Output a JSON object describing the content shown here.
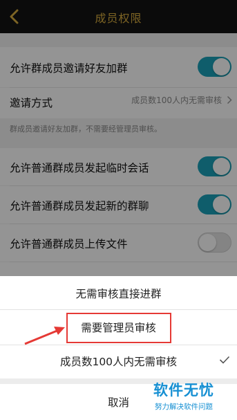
{
  "header": {
    "title": "成员权限"
  },
  "settings": {
    "allow_invite": {
      "label": "允许群成员邀请好友加群",
      "state": "on"
    },
    "invite_method": {
      "label": "邀请方式",
      "value": "成员数100人内无需审核"
    },
    "hint": "群成员邀请好友加群，不需要经管理员审核。",
    "temp_chat": {
      "label": "允许普通群成员发起临时会话",
      "state": "on"
    },
    "new_group": {
      "label": "允许普通群成员发起新的群聊",
      "state": "on"
    },
    "upload_file": {
      "label": "允许普通群成员上传文件",
      "state": "off"
    }
  },
  "sheet": {
    "options": [
      {
        "label": "无需审核直接进群",
        "selected": false
      },
      {
        "label": "需要管理员审核",
        "selected": false
      },
      {
        "label": "成员数100人内无需审核",
        "selected": true
      }
    ],
    "cancel_label": "取消"
  },
  "watermark": {
    "main": "软件无忧",
    "sub": "努力解决软件问题"
  },
  "colors": {
    "accent_gold": "#d8ad3f",
    "toggle_on": "#1aa1b8",
    "highlight_red": "#e53935",
    "watermark_blue": "#1790d3"
  }
}
